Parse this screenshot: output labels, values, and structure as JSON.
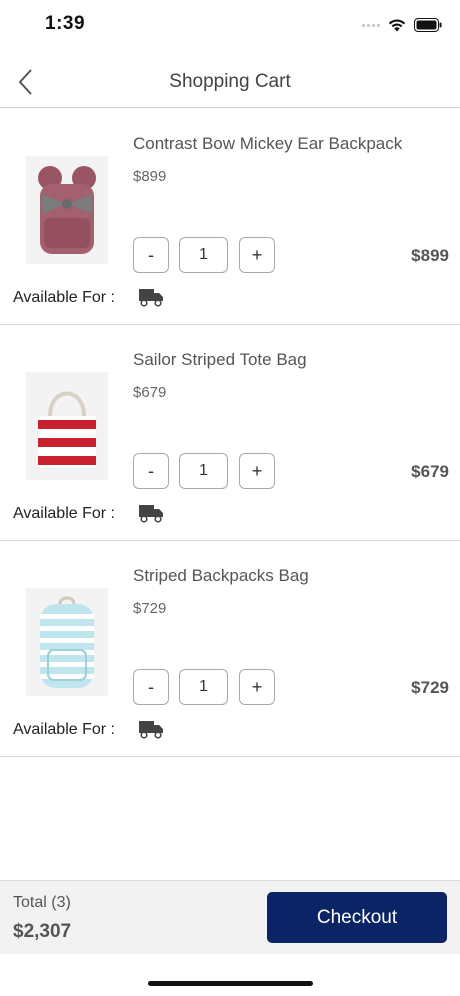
{
  "status_bar": {
    "time": "1:39"
  },
  "header": {
    "title": "Shopping Cart"
  },
  "items": [
    {
      "name": "Contrast Bow Mickey Ear Backpack",
      "price": "$899",
      "quantity": "1",
      "total": "$899",
      "available_label": "Available For :",
      "image": "pink-backpack"
    },
    {
      "name": "Sailor Striped Tote Bag",
      "price": "$679",
      "quantity": "1",
      "total": "$679",
      "available_label": "Available For :",
      "image": "striped-tote"
    },
    {
      "name": "Striped Backpacks Bag",
      "price": "$729",
      "quantity": "1",
      "total": "$729",
      "available_label": "Available For :",
      "image": "blue-backpack"
    }
  ],
  "qty_controls": {
    "minus": "-",
    "plus": "+"
  },
  "footer": {
    "total_label": "Total (3)",
    "total_amount": "$2,307",
    "checkout_label": "Checkout"
  },
  "colors": {
    "accent": "#0b2465",
    "divider": "#d6d6d6"
  }
}
